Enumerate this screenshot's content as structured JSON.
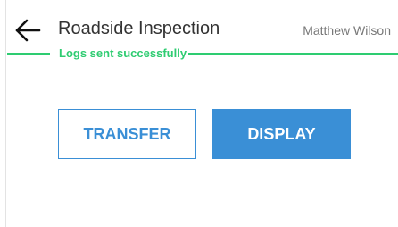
{
  "header": {
    "back_icon": "arrow-left-icon",
    "title": "Roadside Inspection",
    "user_name": "Matthew Wilson"
  },
  "status": {
    "message": "Logs sent successfully",
    "color": "#2ecc71"
  },
  "actions": {
    "transfer_label": "TRANSFER",
    "display_label": "DISPLAY",
    "accent_color": "#3a8fd6"
  }
}
